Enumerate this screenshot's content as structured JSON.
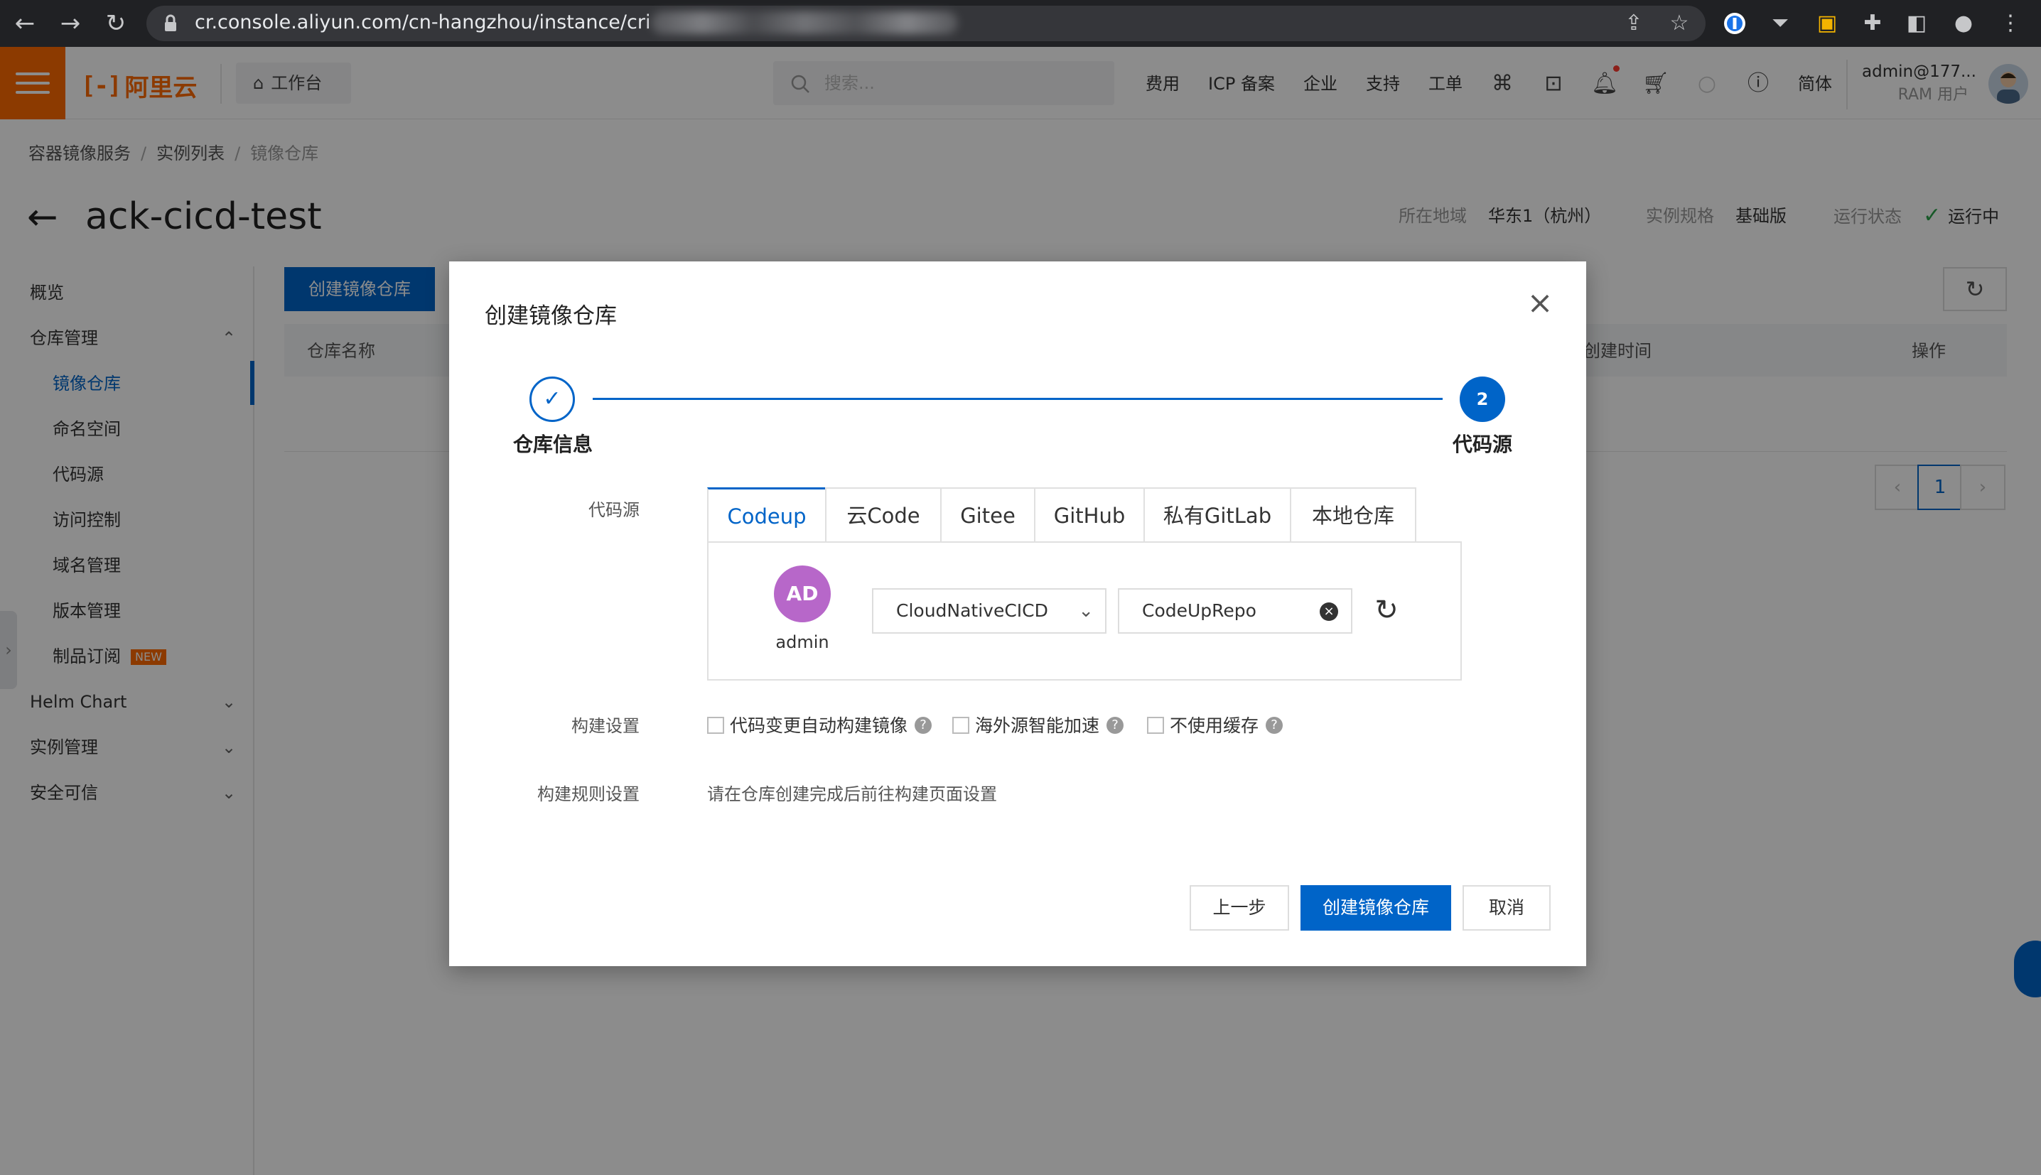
{
  "browser": {
    "url": "cr.console.aliyun.com/cn-hangzhou/instance/cri"
  },
  "header": {
    "logo_text": "阿里云",
    "workbench": "工作台",
    "search_placeholder": "搜索...",
    "nav": [
      "费用",
      "ICP 备案",
      "企业",
      "支持",
      "工单"
    ],
    "lang": "简体",
    "account_name": "admin@177...",
    "account_role": "RAM 用户"
  },
  "breadcrumb": [
    "容器镜像服务",
    "实例列表",
    "镜像仓库"
  ],
  "page": {
    "title": "ack-cicd-test",
    "region_label": "所在地域",
    "region_value": "华东1（杭州）",
    "spec_label": "实例规格",
    "spec_value": "基础版",
    "status_label": "运行状态",
    "status_value": "运行中"
  },
  "sidebar": {
    "overview": "概览",
    "repo_mgmt": "仓库管理",
    "items": [
      "镜像仓库",
      "命名空间",
      "代码源",
      "访问控制",
      "域名管理",
      "版本管理",
      "制品订阅"
    ],
    "new_badge": "NEW",
    "helm": "Helm Chart",
    "instance_mgmt": "实例管理",
    "security": "安全可信"
  },
  "main": {
    "create_button": "创建镜像仓库",
    "col_name": "仓库名称",
    "col_created": "创建时间",
    "col_ops": "操作",
    "page_current": "1"
  },
  "modal": {
    "title": "创建镜像仓库",
    "step1_label": "仓库信息",
    "step2_number": "2",
    "step2_label": "代码源",
    "source_label": "代码源",
    "tabs": [
      "Codeup",
      "云Code",
      "Gitee",
      "GitHub",
      "私有GitLab",
      "本地仓库"
    ],
    "avatar_initials": "AD",
    "avatar_name": "admin",
    "org_value": "CloudNativeCICD",
    "repo_value": "CodeUpRepo",
    "build_label": "构建设置",
    "checkboxes": [
      "代码变更自动构建镜像",
      "海外源智能加速",
      "不使用缓存"
    ],
    "rule_label": "构建规则设置",
    "rule_text": "请在仓库创建完成后前往构建页面设置",
    "btn_prev": "上一步",
    "btn_create": "创建镜像仓库",
    "btn_cancel": "取消"
  },
  "colors": {
    "primary": "#0064c8",
    "brand": "#ff6a00",
    "success": "#2aa34a"
  }
}
